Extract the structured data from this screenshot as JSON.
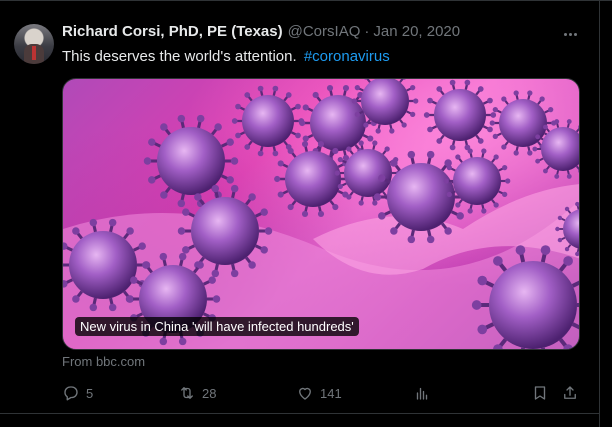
{
  "tweet": {
    "author_name": "Richard Corsi, PhD, PE (Texas)",
    "handle": "@CorsIAQ",
    "separator": "·",
    "date": "Jan 20, 2020",
    "text": "This deserves the world's attention.",
    "hashtag": "#coronavirus"
  },
  "media": {
    "caption": "New virus in China 'will have infected hundreds'",
    "source": "From bbc.com"
  },
  "actions": {
    "replies": "5",
    "retweets": "28",
    "likes": "141"
  },
  "icons": {
    "more": "more-dots-icon",
    "reply": "reply-icon",
    "retweet": "retweet-icon",
    "like": "heart-icon",
    "views": "analytics-icon",
    "bookmark": "bookmark-icon",
    "share": "share-icon"
  },
  "colors": {
    "background": "#000000",
    "text": "#e7e9ea",
    "secondary": "#71767b",
    "link": "#1d9bf0",
    "border": "#2f3336"
  }
}
